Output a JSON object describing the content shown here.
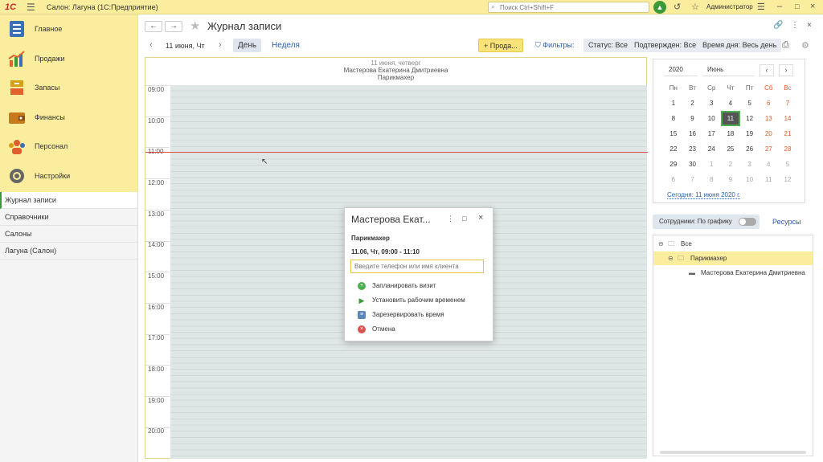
{
  "topbar": {
    "logo": "1С",
    "app_title": "Салон: Лагуна  (1С:Предприятие)",
    "search_placeholder": "Поиск Ctrl+Shift+F",
    "user": "Администратор"
  },
  "sidebar": {
    "sections": [
      {
        "label": "Главное",
        "icon": "main-sections-icon",
        "color": "#3d6fb6"
      },
      {
        "label": "Продажи",
        "icon": "sales-chart-icon",
        "color": "#e1632b"
      },
      {
        "label": "Запасы",
        "icon": "stock-box-icon",
        "color": "#d4a017"
      },
      {
        "label": "Финансы",
        "icon": "wallet-icon",
        "color": "#c9791d"
      },
      {
        "label": "Персонал",
        "icon": "staff-icon",
        "color": "#e05d2d"
      },
      {
        "label": "Настройки",
        "icon": "gear-icon",
        "color": "#555555"
      }
    ],
    "nav": [
      "Журнал записи",
      "Справочники",
      "Салоны",
      "Лагуна (Салон)"
    ]
  },
  "header": {
    "title": "Журнал записи"
  },
  "toolbar": {
    "date": "11 июня, Чт",
    "day": "День",
    "week": "Неделя",
    "sale": "+ Прода...",
    "filters": "Фильтры:",
    "status": "Статус: Все",
    "confirmed": "Подтвержден: Все",
    "daytime": "Время дня: Весь день"
  },
  "schedule": {
    "date_header": "11 июня, четверг",
    "employee": "Мастерова Екатерина Дмитриевна",
    "role": "Парикмахер",
    "hours": [
      "09:00",
      "10:00",
      "11:00",
      "12:00",
      "13:00",
      "14:00",
      "15:00",
      "16:00",
      "17:00",
      "18:00",
      "19:00",
      "20:00"
    ]
  },
  "popup": {
    "title": "Мастерова Екат...",
    "role": "Парикмахер",
    "time": "11.06, Чт, 09:00 - 11:10",
    "input_placeholder": "Введите телефон или имя клиента",
    "actions": [
      {
        "label": "Запланировать визит",
        "icon": "plus-circle-icon",
        "color": "#4caf50"
      },
      {
        "label": "Установить рабочим временем",
        "icon": "play-icon",
        "color": "#3a9a3a"
      },
      {
        "label": "Зарезервировать время",
        "icon": "reserve-icon",
        "color": "#5a86b8"
      },
      {
        "label": "Отмена",
        "icon": "cancel-icon",
        "color": "#d9534f"
      }
    ]
  },
  "mini_calendar": {
    "year": "2020",
    "month": "Июнь",
    "weekdays": [
      "Пн",
      "Вт",
      "Ср",
      "Чт",
      "Пт",
      "Сб",
      "Вс"
    ],
    "weeks": [
      [
        "1",
        "2",
        "3",
        "4",
        "5",
        "6",
        "7"
      ],
      [
        "8",
        "9",
        "10",
        "11",
        "12",
        "13",
        "14"
      ],
      [
        "15",
        "16",
        "17",
        "18",
        "19",
        "20",
        "21"
      ],
      [
        "22",
        "23",
        "24",
        "25",
        "26",
        "27",
        "28"
      ],
      [
        "29",
        "30",
        "1",
        "2",
        "3",
        "4",
        "5"
      ],
      [
        "6",
        "7",
        "8",
        "9",
        "10",
        "11",
        "12"
      ]
    ],
    "selected_day": "11",
    "today_link": "Сегодня: 11 июня 2020 г."
  },
  "staff": {
    "toggle_label": "Сотрудники: По графику",
    "resources": "Ресурсы",
    "tree": [
      {
        "label": "Все",
        "level": 0
      },
      {
        "label": "Парикмахер",
        "level": 1
      },
      {
        "label": "Мастерова Екатерина Дмитриевна",
        "level": 2
      }
    ]
  }
}
